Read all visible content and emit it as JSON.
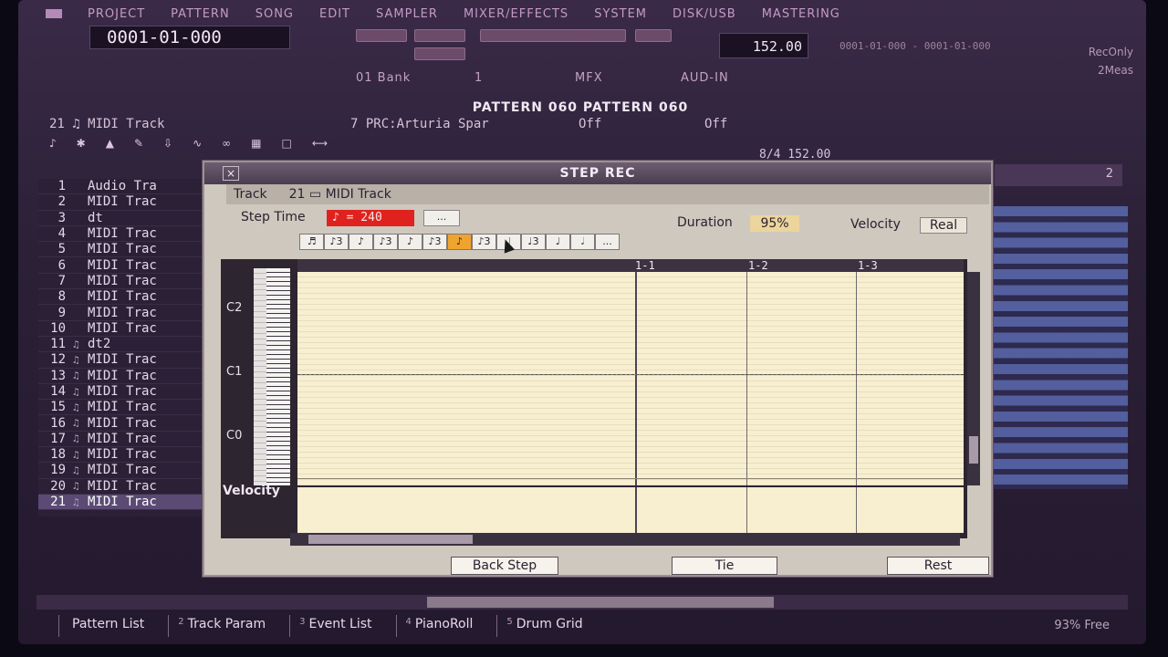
{
  "menu": [
    "PROJECT",
    "PATTERN",
    "SONG",
    "EDIT",
    "SAMPLER",
    "MIXER/EFFECTS",
    "SYSTEM",
    "DISK/USB",
    "MASTERING"
  ],
  "transport": {
    "position": "0001-01-000",
    "tempo": "152.00",
    "position_range": "0001-01-000 - 0001-01-000",
    "rec_mode": "RecOnly",
    "meas": "2Meas"
  },
  "toolbar2": {
    "bank": "01 Bank",
    "bank_num": "1",
    "mfx": "MFX",
    "audio_in": "AUD-IN"
  },
  "pattern_header": "PATTERN 060 PATTERN 060",
  "track_info": {
    "track": "21 ♫ MIDI Track",
    "program": "7 PRC:Arturia Spar",
    "off1": "Off",
    "off2": "Off"
  },
  "meter": "8/4 152.00",
  "pattern_grid_label": "2",
  "tracks": [
    {
      "num": "1",
      "icon": "",
      "name": "Audio Tra"
    },
    {
      "num": "2",
      "icon": "",
      "name": "MIDI Trac"
    },
    {
      "num": "3",
      "icon": "",
      "name": "dt"
    },
    {
      "num": "4",
      "icon": "",
      "name": "MIDI Trac"
    },
    {
      "num": "5",
      "icon": "",
      "name": "MIDI Trac"
    },
    {
      "num": "6",
      "icon": "",
      "name": "MIDI Trac"
    },
    {
      "num": "7",
      "icon": "",
      "name": "MIDI Trac"
    },
    {
      "num": "8",
      "icon": "",
      "name": "MIDI Trac"
    },
    {
      "num": "9",
      "icon": "",
      "name": "MIDI Trac"
    },
    {
      "num": "10",
      "icon": "",
      "name": "MIDI Trac"
    },
    {
      "num": "11",
      "icon": "♫",
      "name": "dt2"
    },
    {
      "num": "12",
      "icon": "♫",
      "name": "MIDI Trac"
    },
    {
      "num": "13",
      "icon": "♫",
      "name": "MIDI Trac"
    },
    {
      "num": "14",
      "icon": "♫",
      "name": "MIDI Trac"
    },
    {
      "num": "15",
      "icon": "♫",
      "name": "MIDI Trac"
    },
    {
      "num": "16",
      "icon": "♫",
      "name": "MIDI Trac"
    },
    {
      "num": "17",
      "icon": "♫",
      "name": "MIDI Trac"
    },
    {
      "num": "18",
      "icon": "♫",
      "name": "MIDI Trac"
    },
    {
      "num": "19",
      "icon": "♫",
      "name": "MIDI Trac"
    },
    {
      "num": "20",
      "icon": "♫",
      "name": "MIDI Trac"
    },
    {
      "num": "21",
      "icon": "♫",
      "name": "MIDI Trac",
      "selected": true
    }
  ],
  "dialog": {
    "title": "STEP REC",
    "close": "×",
    "track_label": "Track",
    "track_num": "21",
    "track_name": "MIDI Track",
    "step_time_label": "Step Time",
    "step_time_value": "♪ = 240",
    "dots": "...",
    "duration_label": "Duration",
    "duration_value": "95%",
    "velocity_label": "Velocity",
    "velocity_value": "Real",
    "note_buttons": [
      "♬",
      "♪3",
      "♪",
      "♪3",
      "♪",
      "♪3",
      "♪",
      "♪3",
      "♩",
      "♩3",
      "♩",
      "𝅗𝅥",
      "..."
    ],
    "active_note_index": 6,
    "octaves": [
      "C2",
      "C1",
      "C0"
    ],
    "beats": [
      "1-1",
      "1-2",
      "1-3"
    ],
    "velocity_lane_label": "Velocity",
    "back_step": "Back Step",
    "tie": "Tie",
    "rest": "Rest"
  },
  "tabs": [
    {
      "num": "",
      "label": "Pattern List"
    },
    {
      "num": "2",
      "label": "Track Param"
    },
    {
      "num": "3",
      "label": "Event List"
    },
    {
      "num": "4",
      "label": "PianoRoll"
    },
    {
      "num": "5",
      "label": "Drum Grid"
    }
  ],
  "free_space": "93% Free"
}
